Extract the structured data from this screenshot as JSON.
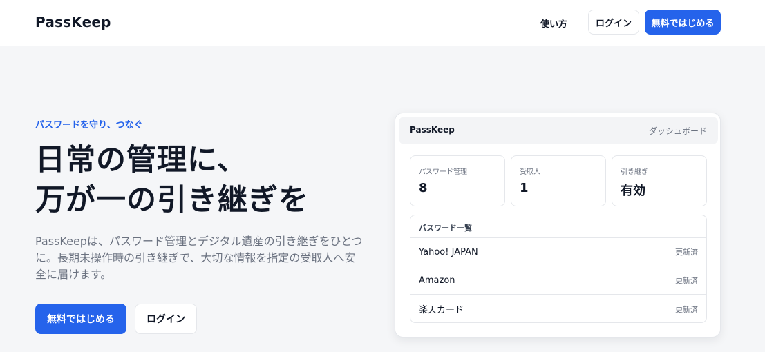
{
  "header": {
    "brand": "PassKeep",
    "nav_link": "使い方",
    "login_label": "ログイン",
    "start_label": "無料ではじめる"
  },
  "hero": {
    "eyebrow": "パスワードを守り、つなぐ",
    "title_line1": "日常の管理に、",
    "title_line2": "万が一の引き継ぎを",
    "description": "PassKeepは、パスワード管理とデジタル遺産の引き継ぎをひとつに。長期未操作時の引き継ぎで、大切な情報を指定の受取人へ安全に届けます。",
    "cta_start": "無料ではじめる",
    "cta_login": "ログイン"
  },
  "dashboard": {
    "brand": "PassKeep",
    "tag": "ダッシュボード",
    "stats": [
      {
        "label": "パスワード管理",
        "value": "8"
      },
      {
        "label": "受取人",
        "value": "1"
      },
      {
        "label": "引き継ぎ",
        "value": "有効"
      }
    ],
    "list_title": "パスワード一覧",
    "rows": [
      {
        "name": "Yahoo! JAPAN",
        "status": "更新済"
      },
      {
        "name": "Amazon",
        "status": "更新済"
      },
      {
        "name": "楽天カード",
        "status": "更新済"
      }
    ]
  },
  "colors": {
    "accent": "#2563eb",
    "background": "#f5f6f8",
    "text": "#111827",
    "muted": "#6b7280"
  }
}
